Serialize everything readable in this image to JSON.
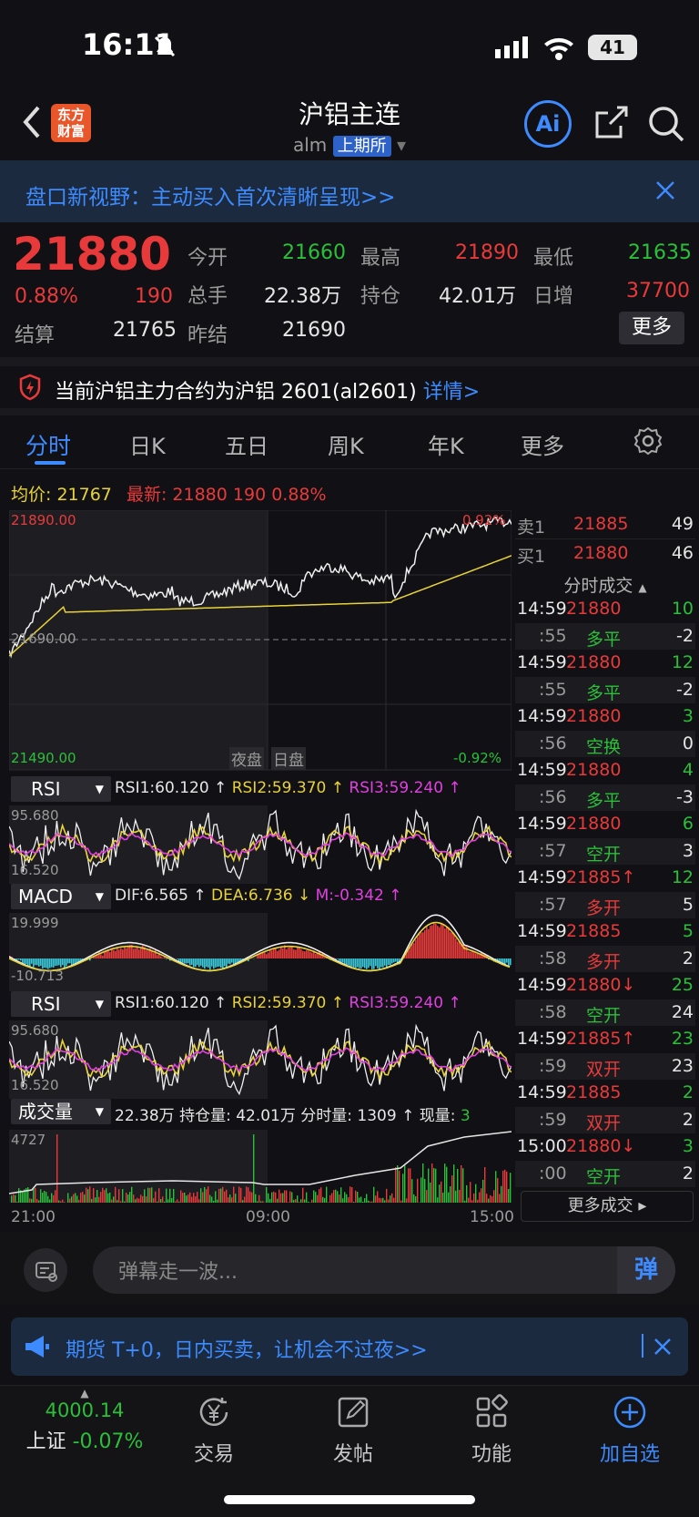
{
  "status": {
    "time": "16:11",
    "battery": "41"
  },
  "header": {
    "logo": "东方\n财富",
    "title": "沪铝主连",
    "code": "alm",
    "exchange": "上期所",
    "ai_label": "Ai"
  },
  "banner": {
    "text": "盘口新视野：主动买入首次清晰呈现>>"
  },
  "quote": {
    "price": "21880",
    "pct": "0.88%",
    "change": "190",
    "open_label": "今开",
    "open": "21660",
    "high_label": "最高",
    "high": "21890",
    "low_label": "最低",
    "low": "21635",
    "volume_label": "总手",
    "volume": "22.38万",
    "oi_label": "持仓",
    "oi": "42.01万",
    "daily_inc_label": "日增",
    "daily_inc": "37700",
    "settle_label": "结算",
    "settle": "21765",
    "prev_settle_label": "昨结",
    "prev_settle": "21690",
    "more": "更多"
  },
  "notice": {
    "text": "当前沪铝主力合约为沪铝 2601(al2601)",
    "link": "详情>"
  },
  "tabs": [
    "分时",
    "日K",
    "五日",
    "周K",
    "年K",
    "更多"
  ],
  "chart_info": {
    "avg_label": "均价:",
    "avg": "21767",
    "latest_label": "最新:",
    "latest": "21880",
    "change": "190",
    "pct": "0.88%"
  },
  "price_chart": {
    "top_price": "21890.00",
    "mid_price": "21690.00",
    "bottom_price": "21490.00",
    "top_pct": "0.92%",
    "bottom_pct": "-0.92%",
    "night": "夜盘",
    "day": "日盘"
  },
  "rsi": {
    "label": "RSI",
    "rsi1": "RSI1:60.120 ↑",
    "rsi2": "RSI2:59.370 ↑",
    "rsi3": "RSI3:59.240 ↑",
    "top": "95.680",
    "bottom": "16.520"
  },
  "macd": {
    "label": "MACD",
    "dif": "DIF:6.565 ↑",
    "dea": "DEA:6.736 ↓",
    "m": "M:-0.342 ↑",
    "top": "19.999",
    "bottom": "-10.713"
  },
  "volume": {
    "label": "成交量",
    "text1": "22.38万 持仓量: 42.01万 分时量: 1309 ↑ 现量:",
    "now": "3",
    "top": "4727"
  },
  "xaxis": [
    "21:00",
    "09:00",
    "15:00"
  ],
  "orderbook": {
    "sell_label": "卖1",
    "sell_price": "21885",
    "sell_qty": "49",
    "buy_label": "买1",
    "buy_price": "21880",
    "buy_qty": "46",
    "trades_title": "分时成交",
    "trades": [
      {
        "t": "14:59",
        "p": "21880",
        "v": "10",
        "s": ":55",
        "k": "多平",
        "q": "-2",
        "pc": "red",
        "kc": "green"
      },
      {
        "t": "14:59",
        "p": "21880",
        "v": "12",
        "s": ":55",
        "k": "多平",
        "q": "-2",
        "pc": "red",
        "kc": "green"
      },
      {
        "t": "14:59",
        "p": "21880",
        "v": "3",
        "s": ":56",
        "k": "空换",
        "q": "0",
        "pc": "red",
        "kc": "green"
      },
      {
        "t": "14:59",
        "p": "21880",
        "v": "4",
        "s": ":56",
        "k": "多平",
        "q": "-3",
        "pc": "red",
        "kc": "green"
      },
      {
        "t": "14:59",
        "p": "21880",
        "v": "6",
        "s": ":57",
        "k": "空开",
        "q": "3",
        "pc": "red",
        "kc": "green"
      },
      {
        "t": "14:59",
        "p": "21885↑",
        "v": "12",
        "s": ":57",
        "k": "多开",
        "q": "5",
        "pc": "red",
        "kc": "red"
      },
      {
        "t": "14:59",
        "p": "21885",
        "v": "5",
        "s": ":58",
        "k": "多开",
        "q": "2",
        "pc": "red",
        "kc": "red"
      },
      {
        "t": "14:59",
        "p": "21880↓",
        "v": "25",
        "s": ":58",
        "k": "空开",
        "q": "24",
        "pc": "red",
        "kc": "green"
      },
      {
        "t": "14:59",
        "p": "21885↑",
        "v": "23",
        "s": ":59",
        "k": "双开",
        "q": "23",
        "pc": "red",
        "kc": "red"
      },
      {
        "t": "14:59",
        "p": "21885",
        "v": "2",
        "s": ":59",
        "k": "双开",
        "q": "2",
        "pc": "red",
        "kc": "red"
      },
      {
        "t": "15:00",
        "p": "21880↓",
        "v": "3",
        "s": ":00",
        "k": "空开",
        "q": "2",
        "pc": "red",
        "kc": "green"
      }
    ],
    "more_trades": "更多成交"
  },
  "danmu": {
    "placeholder": "弹幕走一波...",
    "send": "弹"
  },
  "promo": {
    "text": "期货 T+0，日内买卖，让机会不过夜>>"
  },
  "bottom": {
    "index_value": "4000.14",
    "index_name": "上证",
    "index_pct": "-0.07%",
    "trade": "交易",
    "post": "发帖",
    "func": "功能",
    "watch": "加自选"
  }
}
